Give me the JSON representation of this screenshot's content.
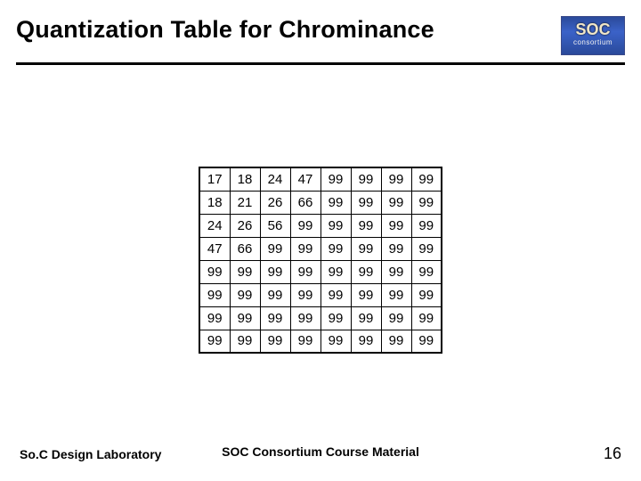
{
  "title": "Quantization Table for Chrominance",
  "logo": {
    "top": "SOC",
    "bottom": "consortium"
  },
  "chart_data": {
    "type": "table",
    "title": "Quantization Table for Chrominance",
    "rows": [
      [
        17,
        18,
        24,
        47,
        99,
        99,
        99,
        99
      ],
      [
        18,
        21,
        26,
        66,
        99,
        99,
        99,
        99
      ],
      [
        24,
        26,
        56,
        99,
        99,
        99,
        99,
        99
      ],
      [
        47,
        66,
        99,
        99,
        99,
        99,
        99,
        99
      ],
      [
        99,
        99,
        99,
        99,
        99,
        99,
        99,
        99
      ],
      [
        99,
        99,
        99,
        99,
        99,
        99,
        99,
        99
      ],
      [
        99,
        99,
        99,
        99,
        99,
        99,
        99,
        99
      ],
      [
        99,
        99,
        99,
        99,
        99,
        99,
        99,
        99
      ]
    ]
  },
  "footer": {
    "left": "So.C Design Laboratory",
    "center": "SOC Consortium Course Material",
    "page": "16"
  }
}
